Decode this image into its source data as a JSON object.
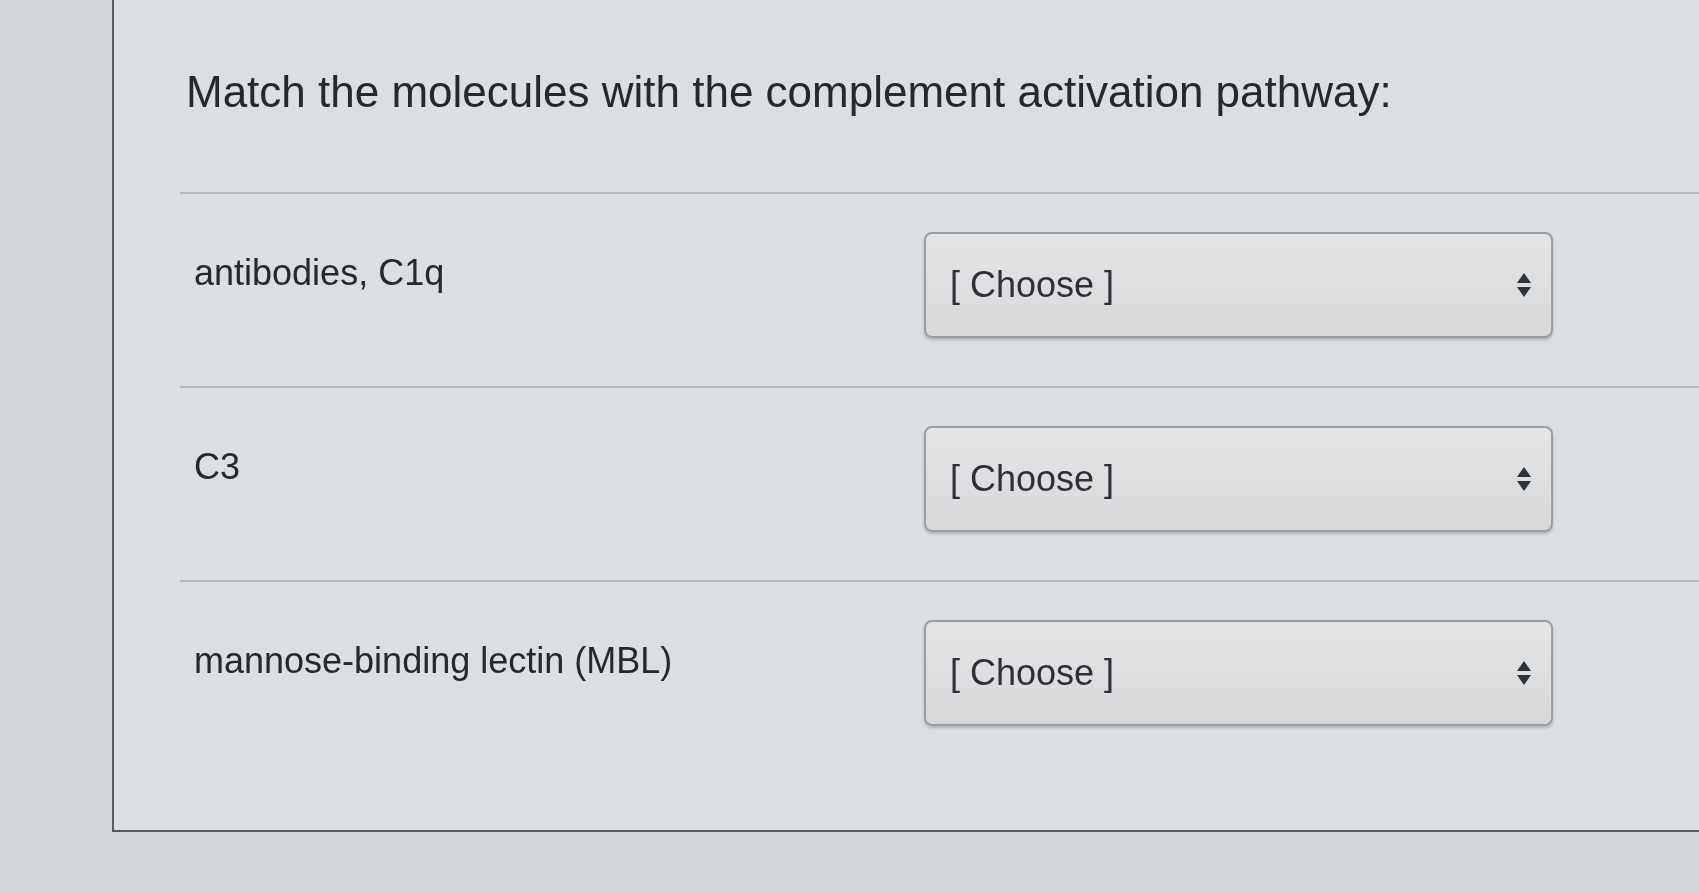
{
  "question": {
    "title": "Match the molecules with the complement activation pathway:"
  },
  "rows": [
    {
      "term": "antibodies, C1q",
      "dropdown": {
        "value": "[ Choose ]"
      }
    },
    {
      "term": "C3",
      "dropdown": {
        "value": "[ Choose ]"
      }
    },
    {
      "term": "mannose-binding lectin (MBL)",
      "dropdown": {
        "value": "[ Choose ]"
      }
    }
  ]
}
